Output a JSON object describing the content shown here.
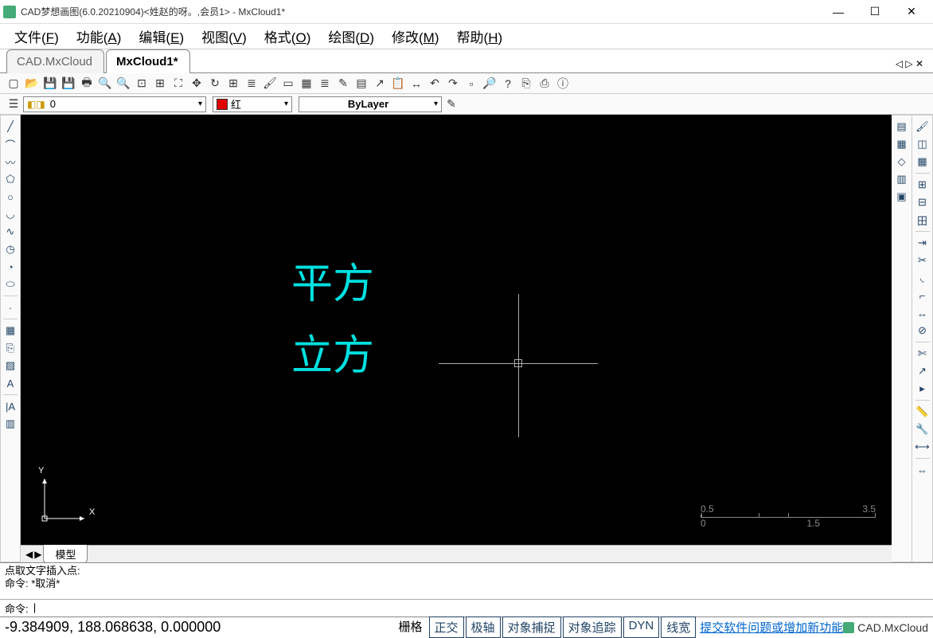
{
  "window": {
    "title": "CAD梦想画图(6.0.20210904)<姓赵的呀。,会员1> - MxCloud1*"
  },
  "menu": [
    {
      "label": "文件",
      "key": "F"
    },
    {
      "label": "功能",
      "key": "A"
    },
    {
      "label": "编辑",
      "key": "E"
    },
    {
      "label": "视图",
      "key": "V"
    },
    {
      "label": "格式",
      "key": "O"
    },
    {
      "label": "绘图",
      "key": "D"
    },
    {
      "label": "修改",
      "key": "M"
    },
    {
      "label": "帮助",
      "key": "H"
    }
  ],
  "doc_tabs": [
    {
      "label": "CAD.MxCloud",
      "active": false
    },
    {
      "label": "MxCloud1*",
      "active": true
    }
  ],
  "toolbar1_icons": [
    "new",
    "open",
    "save",
    "saveall",
    "plot",
    "zoom-in",
    "zoom-out",
    "zoom-all",
    "zoom-window",
    "zoom-ext",
    "pan",
    "regen",
    "props",
    "layer",
    "paint",
    "area",
    "hatch",
    "layers",
    "brush",
    "script",
    "export",
    "clipboard",
    "dist",
    "undo",
    "redo",
    "blank",
    "find",
    "help",
    "link",
    "pdf",
    "about"
  ],
  "layer_combo": {
    "icons": "◧◨",
    "value": "0"
  },
  "color_combo": {
    "swatch": "#e00000",
    "value": "红"
  },
  "linetype_combo": {
    "value": "ByLayer"
  },
  "ltool_icons": [
    "line",
    "arc-seg",
    "polyline",
    "polygon",
    "circle",
    "arc",
    "curve",
    "clock",
    "ellipse-arc",
    "ellipse",
    "sep",
    "dot",
    "sep",
    "block",
    "insert",
    "hatch",
    "text-a",
    "sep",
    "mtext-ia",
    "measure"
  ],
  "rtool_left": [
    "copy-layers",
    "props",
    "grip",
    "layers2",
    "copy2"
  ],
  "rtool_right": [
    "brush",
    "eraser",
    "hatch2",
    "sep",
    "array",
    "grid3",
    "grid-center",
    "sep",
    "extend",
    "trim",
    "fillet",
    "corner",
    "stretch",
    "break",
    "sep",
    "scissors",
    "arrow",
    "pointer",
    "sep",
    "ruler",
    "wrench",
    "dim-continue",
    "sep",
    "mirror-h"
  ],
  "canvas": {
    "text1": "平方",
    "text2": "立方",
    "ucs_x": "X",
    "ucs_y": "Y",
    "scale_labels": [
      "0.5",
      "3.5",
      "0",
      "1.5"
    ]
  },
  "sheet_tab": "模型",
  "cmd_history": [
    "点取文字插入点:",
    "命令:  *取消*"
  ],
  "cmd_prompt": "命令:",
  "status": {
    "coords": "-9.384909, 188.068638, 0.000000",
    "toggles": [
      "栅格",
      "正交",
      "极轴",
      "对象捕捉",
      "对象追踪",
      "DYN",
      "线宽"
    ],
    "link": "提交软件问题或增加新功能",
    "brand": "CAD.MxCloud"
  }
}
